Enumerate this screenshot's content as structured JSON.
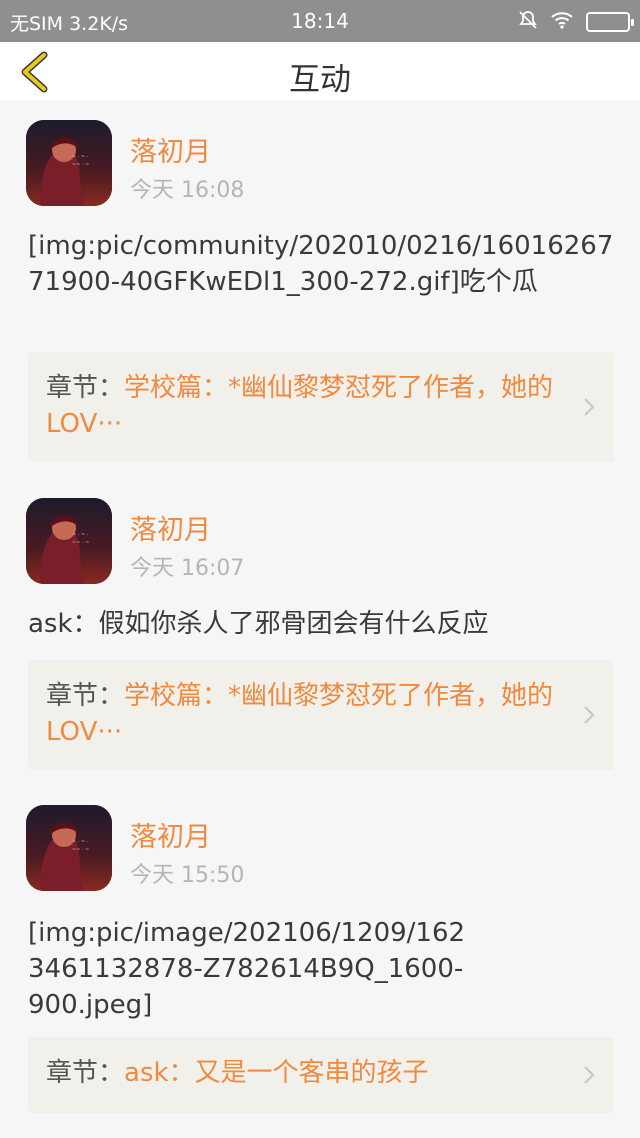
{
  "status_bar": {
    "left_text": "无SIM 3.2K/s",
    "time": "18:14"
  },
  "header": {
    "title": "互动",
    "back_icon": "chevron-left-icon"
  },
  "posts": [
    {
      "username": "落初月",
      "time": "今天 16:08",
      "content": "[img:pic/community/202010/0216/1601626771900-40GFKwEDl1_300-272.gif]吃个瓜",
      "chapter_prefix": "章节：",
      "chapter_name": "学校篇：*幽仙黎梦怼死了作者，她的LOV···"
    },
    {
      "username": "落初月",
      "time": "今天 16:07",
      "content": "ask：假如你杀人了邪骨团会有什么反应",
      "chapter_prefix": "章节：",
      "chapter_name": "学校篇：*幽仙黎梦怼死了作者，她的LOV···"
    },
    {
      "username": "落初月",
      "time": "今天 15:50",
      "content": "[img:pic/image/202106/1209/1623461132878-Z782614B9Q_1600-900.jpeg]",
      "chapter_prefix": "章节：",
      "chapter_name": "ask：又是一个客串的孩子"
    }
  ],
  "colors": {
    "accent": "#ef8a3f",
    "status_bar": "#8f8f8f",
    "back_icon": "#e8c81c"
  }
}
